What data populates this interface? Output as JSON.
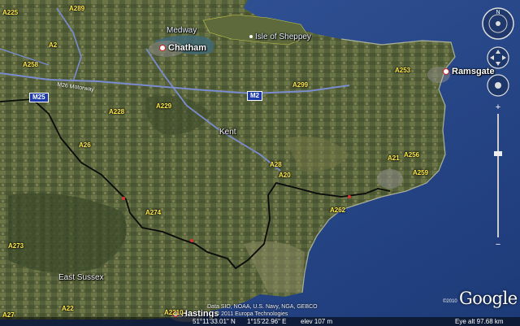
{
  "towns": [
    {
      "id": "chatham",
      "label": "Chatham"
    },
    {
      "id": "ramsgate",
      "label": "Ramsgate"
    },
    {
      "id": "hastings",
      "label": "Hastings"
    }
  ],
  "water": [
    {
      "id": "medway",
      "label": "Medway"
    },
    {
      "id": "sheppey",
      "label": "Isle of Sheppey"
    }
  ],
  "regions": [
    {
      "id": "kent",
      "label": "Kent"
    },
    {
      "id": "east-sussex",
      "label": "East Sussex"
    }
  ],
  "roads": [
    "A289",
    "A225",
    "A2",
    "A228",
    "A229",
    "A299",
    "A253",
    "A256",
    "A20",
    "A21",
    "A26",
    "A262",
    "A273",
    "A22",
    "A259",
    "A258",
    "A2210",
    "A27",
    "A28",
    "A274"
  ],
  "motorways": {
    "m25": "M25",
    "m2": "M2",
    "m26_label": "M26 Motorway"
  },
  "status": {
    "lat": "51°11'33.01\" N",
    "lon": "1°15'22.96\" E",
    "elev": "elev  107 m",
    "eye": "Eye alt   97.68 km"
  },
  "attribution": {
    "imagery": "Data SIO, NOAA, U.S. Navy, NGA, GEBCO",
    "copyright_te": "© 2011 Europa Technologies",
    "copyright_year": "©2010"
  },
  "logo": "Google",
  "colors": {
    "sea": "#2a4a8a",
    "land": "#56613a",
    "border": "#0a0a0a",
    "road": "#ffe94d",
    "motorway": "#1c3aa8"
  }
}
